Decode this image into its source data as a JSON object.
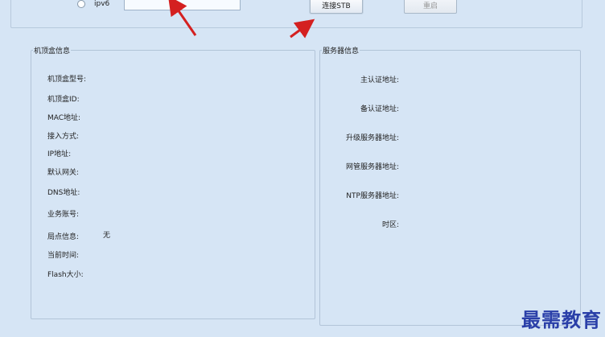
{
  "network": {
    "ipv6_label": "ipv6",
    "ip_value": ""
  },
  "buttons": {
    "connect": "连接STB",
    "reboot": "重启"
  },
  "stb_info": {
    "title": "机顶盒信息",
    "fields": [
      {
        "label": "机顶盒型号:",
        "value": ""
      },
      {
        "label": "机顶盒ID:",
        "value": ""
      },
      {
        "label": "MAC地址:",
        "value": ""
      },
      {
        "label": "接入方式:",
        "value": ""
      },
      {
        "label": "IP地址:",
        "value": ""
      },
      {
        "label": "默认网关:",
        "value": ""
      },
      {
        "label": "DNS地址:",
        "value": ""
      },
      {
        "label": "业务账号:",
        "value": ""
      },
      {
        "label": "局点信息:",
        "value": "无"
      },
      {
        "label": "当前时间:",
        "value": ""
      },
      {
        "label": "Flash大小:",
        "value": ""
      }
    ]
  },
  "server_info": {
    "title": "服务器信息",
    "fields": [
      {
        "label": "主认证地址:",
        "value": ""
      },
      {
        "label": "备认证地址:",
        "value": ""
      },
      {
        "label": "升级服务器地址:",
        "value": ""
      },
      {
        "label": "网管服务器地址:",
        "value": ""
      },
      {
        "label": "NTP服务器地址:",
        "value": ""
      },
      {
        "label": "时区:",
        "value": ""
      }
    ]
  },
  "watermark": "最需教育",
  "colors": {
    "background": "#d6e5f5",
    "annotation_arrow": "#d42020",
    "watermark": "#2a3fa8"
  }
}
